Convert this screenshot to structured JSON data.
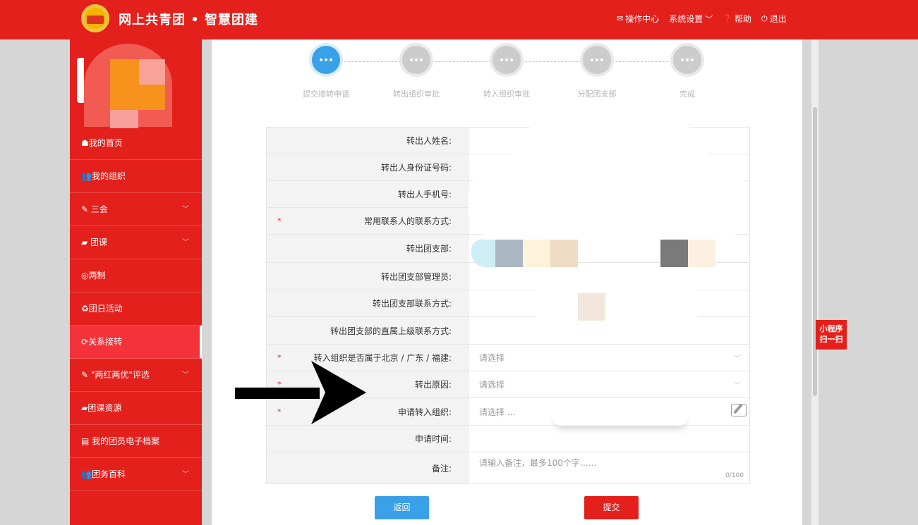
{
  "header": {
    "title": "网上共青团 • 智慧团建",
    "nav": [
      {
        "icon": "mail-icon",
        "label": "操作中心"
      },
      {
        "icon": "settings",
        "label": "系统设置"
      },
      {
        "icon": "help-icon",
        "label": "帮助"
      },
      {
        "icon": "power-icon",
        "label": "退出"
      }
    ]
  },
  "sidebar": {
    "items": [
      {
        "icon": "home-icon",
        "label": "我的首页"
      },
      {
        "icon": "users-icon",
        "label": "我的组织"
      },
      {
        "icon": "edit-icon",
        "label": "三会"
      },
      {
        "icon": "folder-icon",
        "label": "团课"
      },
      {
        "icon": "target-icon",
        "label": "两制"
      },
      {
        "icon": "recycle-icon",
        "label": "团日活动"
      },
      {
        "icon": "refresh-icon",
        "label": "关系接转"
      },
      {
        "icon": "edit-icon",
        "label": "\"两红两优\"评选"
      },
      {
        "icon": "folder-icon",
        "label": "团课资源"
      },
      {
        "icon": "file-icon",
        "label": "我的团员电子档案"
      },
      {
        "icon": "users-icon",
        "label": "团务百科"
      }
    ]
  },
  "steps": [
    {
      "label": "提交接转申请",
      "icon": "•••"
    },
    {
      "label": "转出组织审批",
      "icon": "•••"
    },
    {
      "label": "转入组织审批",
      "icon": "•••"
    },
    {
      "label": "分配团支部",
      "icon": "•••"
    },
    {
      "label": "完成",
      "icon": "•••"
    }
  ],
  "form": {
    "rows": [
      {
        "label": "转出人姓名:",
        "value": ""
      },
      {
        "label": "转出人身份证号码:",
        "value": ""
      },
      {
        "label": "转出人手机号:",
        "value": ""
      },
      {
        "label": "常用联系人的联系方式:",
        "value": "",
        "required": "*"
      },
      {
        "label": "转出团支部:",
        "value": ""
      },
      {
        "label": "转出团支部管理员:",
        "value": ""
      },
      {
        "label": "转出团支部联系方式:",
        "value": ""
      },
      {
        "label": "转出团支部的直属上级联系方式:",
        "value": ""
      },
      {
        "label": "转入组织是否属于北京 / 广东 / 福建:",
        "value": "请选择",
        "required": "*"
      },
      {
        "label": "转出原因:",
        "value": "请选择",
        "required": "*"
      },
      {
        "label": "申请转入组织:",
        "value": "请选择 ...",
        "required": "*"
      },
      {
        "label": "申请时间:",
        "value": ""
      },
      {
        "label": "备注:",
        "placeholder": "请输入备注，最多100个字……",
        "counter": "0/100"
      }
    ]
  },
  "buttons": {
    "back": "返回",
    "submit": "提交"
  },
  "mini_program": {
    "line1": "小程序",
    "line2": "扫一扫"
  }
}
